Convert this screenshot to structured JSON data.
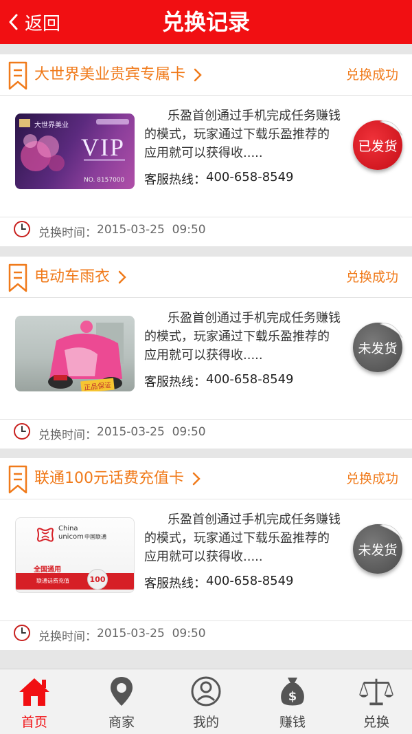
{
  "header": {
    "back_label": "返回",
    "title": "兑换记录"
  },
  "orders": [
    {
      "name": "大世界美业贵宾专属卡",
      "status": "兑换成功",
      "description": "乐盈首创通过手机完成任务赚钱的模式，玩家通过下载乐盈推荐的 应用就可以获得收.....",
      "hotline_label": "客服热线：",
      "hotline": "400-658-8549",
      "badge": "已发货",
      "badge_color": "#d9121c",
      "time_label": "兑换时间：",
      "time": "2015-03-25  09:50",
      "thumb": {
        "brand": "大世界美业",
        "text": "VIP",
        "number": "NO. 8157000"
      }
    },
    {
      "name": "电动车雨衣",
      "status": "兑换成功",
      "description": "乐盈首创通过手机完成任务赚钱的模式，玩家通过下载乐盈推荐的 应用就可以获得收.....",
      "hotline_label": "客服热线：",
      "hotline": "400-658-8549",
      "badge": "未发货",
      "badge_color": "#5a5a5a",
      "time_label": "兑换时间：",
      "time": "2015-03-25  09:50",
      "thumb": {
        "tag": "正品保证"
      }
    },
    {
      "name": "联通100元话费充值卡",
      "status": "兑换成功",
      "description": "乐盈首创通过手机完成任务赚钱的模式，玩家通过下载乐盈推荐的 应用就可以获得收.....",
      "hotline_label": "客服热线：",
      "hotline": "400-658-8549",
      "badge": "未发货",
      "badge_color": "#5a5a5a",
      "time_label": "兑换时间：",
      "time": "2015-03-25  09:50",
      "thumb": {
        "brand_en_1": "China",
        "brand_en_2": "unicom",
        "brand_cn": "中国联通",
        "text_1": "全国通用",
        "text_2": "联通话费充值",
        "value": "100"
      }
    }
  ],
  "tabs": [
    {
      "label": "首页",
      "icon": "home-icon",
      "active": true
    },
    {
      "label": "商家",
      "icon": "location-pin-icon",
      "active": false
    },
    {
      "label": "我的",
      "icon": "user-icon",
      "active": false
    },
    {
      "label": "赚钱",
      "icon": "money-bag-icon",
      "active": false
    },
    {
      "label": "兑换",
      "icon": "scale-icon",
      "active": false
    }
  ],
  "colors": {
    "brand_red": "#f10f12",
    "accent_orange": "#f07a1a"
  }
}
